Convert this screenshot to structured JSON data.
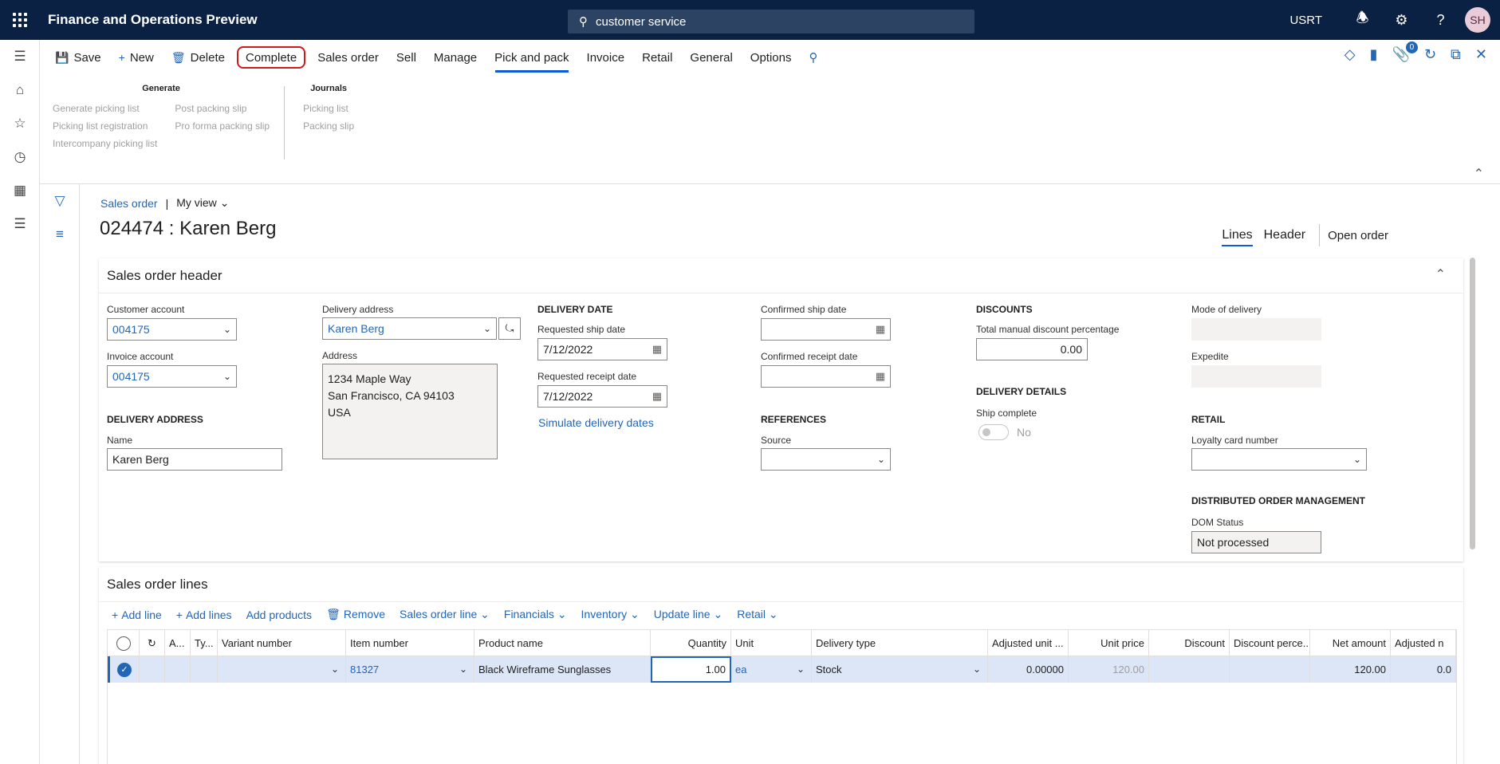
{
  "app": {
    "title": "Finance and Operations Preview",
    "company": "USRT",
    "avatar": "SH"
  },
  "search": {
    "value": "customer service"
  },
  "actions": {
    "save": "Save",
    "new": "New",
    "delete": "Delete",
    "complete": "Complete",
    "tabs": [
      "Sales order",
      "Sell",
      "Manage",
      "Pick and pack",
      "Invoice",
      "Retail",
      "General",
      "Options"
    ],
    "active_tab": "Pick and pack",
    "notification_count": "0"
  },
  "groups": {
    "generate": {
      "title": "Generate",
      "col1": [
        "Generate picking list",
        "Picking list registration",
        "Intercompany picking list"
      ],
      "col2": [
        "Post packing slip",
        "Pro forma packing slip"
      ]
    },
    "journals": {
      "title": "Journals",
      "col1": [
        "Picking list",
        "Packing slip"
      ]
    }
  },
  "breadcrumb": {
    "link": "Sales order",
    "sep": "|",
    "view": "My view"
  },
  "page_title": "024474 : Karen Berg",
  "view_tabs": {
    "lines": "Lines",
    "header": "Header",
    "open_order": "Open order"
  },
  "header_card": {
    "title": "Sales order header",
    "customer_account_label": "Customer account",
    "customer_account": "004175",
    "invoice_account_label": "Invoice account",
    "invoice_account": "004175",
    "delivery_address_section": "DELIVERY ADDRESS",
    "name_label": "Name",
    "name": "Karen Berg",
    "delivery_address_label": "Delivery address",
    "delivery_address": "Karen Berg",
    "address_label": "Address",
    "address_line1": "1234 Maple Way",
    "address_line2": "San Francisco, CA 94103",
    "address_line3": "USA",
    "delivery_date_section": "DELIVERY DATE",
    "req_ship_label": "Requested ship date",
    "req_ship": "7/12/2022",
    "req_receipt_label": "Requested receipt date",
    "req_receipt": "7/12/2022",
    "simulate": "Simulate delivery dates",
    "conf_ship_label": "Confirmed ship date",
    "conf_receipt_label": "Confirmed receipt date",
    "references_section": "REFERENCES",
    "source_label": "Source",
    "discounts_section": "DISCOUNTS",
    "discount_pct_label": "Total manual discount percentage",
    "discount_pct": "0.00",
    "delivery_details_section": "DELIVERY DETAILS",
    "ship_complete_label": "Ship complete",
    "ship_complete": "No",
    "mode_label": "Mode of delivery",
    "expedite_label": "Expedite",
    "retail_section": "RETAIL",
    "loyalty_label": "Loyalty card number",
    "dom_section": "DISTRIBUTED ORDER MANAGEMENT",
    "dom_status_label": "DOM Status",
    "dom_status": "Not processed"
  },
  "lines_card": {
    "title": "Sales order lines",
    "toolbar": [
      "Add line",
      "Add lines",
      "Add products",
      "Remove",
      "Sales order line",
      "Financials",
      "Inventory",
      "Update line",
      "Retail"
    ],
    "columns": [
      "A...",
      "Ty...",
      "Variant number",
      "Item number",
      "Product name",
      "Quantity",
      "Unit",
      "Delivery type",
      "Adjusted unit ...",
      "Unit price",
      "Discount",
      "Discount perce...",
      "Net amount",
      "Adjusted n"
    ],
    "row": {
      "item": "81327",
      "product": "Black Wireframe Sunglasses",
      "quantity": "1.00",
      "unit": "ea",
      "delivery_type": "Stock",
      "adjusted_unit": "0.00000",
      "unit_price": "120.00",
      "net_amount": "120.00",
      "adjusted_n": "0.0"
    }
  }
}
